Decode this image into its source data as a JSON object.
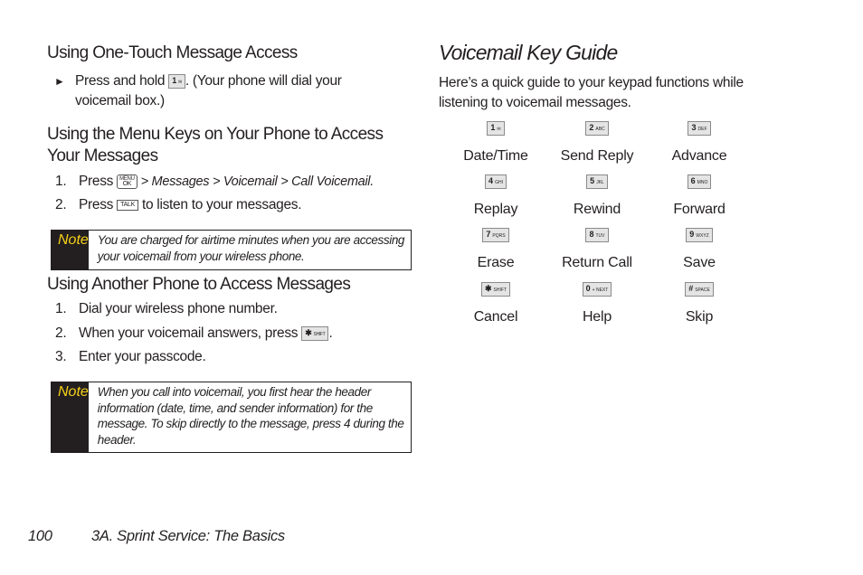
{
  "left": {
    "section1": {
      "heading": "Using One-Touch Message Access",
      "bullet_pre": "Press and hold",
      "bullet_key": {
        "num": "1",
        "sub": "✉"
      },
      "bullet_post": ". (Your phone will dial your",
      "bullet_line2": "voicemail box.)"
    },
    "section2": {
      "heading_line1": "Using the Menu Keys on Your Phone to Access",
      "heading_line2": "Your Messages",
      "steps": [
        {
          "num": "1.",
          "pre": "Press",
          "key_top": "MENU",
          "key_bottom": "OK",
          "path": "> Messages > Voicemail > Call Voicemail."
        },
        {
          "num": "2.",
          "pre": "Press",
          "key": "TALK",
          "post": "to listen to your messages."
        }
      ]
    },
    "note1": {
      "label": "Note",
      "text": "You are charged for airtime minutes when you are accessing your voicemail from your wireless phone."
    },
    "section3": {
      "heading": "Using Another Phone to Access Messages",
      "steps": [
        {
          "num": "1.",
          "text": "Dial your wireless phone number."
        },
        {
          "num": "2.",
          "text": "When your voicemail answers, press",
          "key": {
            "num": "✱",
            "sub": "SHIFT"
          },
          "post": "."
        },
        {
          "num": "3.",
          "text": "Enter your passcode."
        }
      ]
    },
    "note2": {
      "label": "Note",
      "text": "When you call into voicemail, you first hear the header information (date, time, and sender information) for the message. To skip directly to the message, press 4 during the header."
    }
  },
  "right": {
    "title": "Voicemail Key Guide",
    "intro_line1": "Here’s a quick guide to your keypad functions while",
    "intro_line2": "listening to voicemail messages.",
    "keys": [
      {
        "num": "1",
        "sub": "✉",
        "label": "Date/Time"
      },
      {
        "num": "2",
        "sub": "ABC",
        "label": "Send Reply"
      },
      {
        "num": "3",
        "sub": "DEF",
        "label": "Advance"
      },
      {
        "num": "4",
        "sub": "GHI",
        "label": "Replay"
      },
      {
        "num": "5",
        "sub": "JKL",
        "label": "Rewind"
      },
      {
        "num": "6",
        "sub": "MNO",
        "label": "Forward"
      },
      {
        "num": "7",
        "sub": "PQRS",
        "label": "Erase"
      },
      {
        "num": "8",
        "sub": "TUV",
        "label": "Return Call"
      },
      {
        "num": "9",
        "sub": "WXYZ",
        "label": "Save"
      },
      {
        "num": "✱",
        "sub": "SHIFT",
        "label": "Cancel"
      },
      {
        "num": "0",
        "sub": "+ NEXT",
        "label": "Help"
      },
      {
        "num": "#",
        "sub": "SPACE",
        "label": "Skip"
      }
    ]
  },
  "footer": {
    "page_number": "100",
    "section_title": "3A. Sprint Service: The Basics"
  },
  "colors": {
    "text": "#231f20",
    "note_bg": "#231f20",
    "note_label": "#f7d117",
    "key_bg": "#e4e4e4"
  }
}
